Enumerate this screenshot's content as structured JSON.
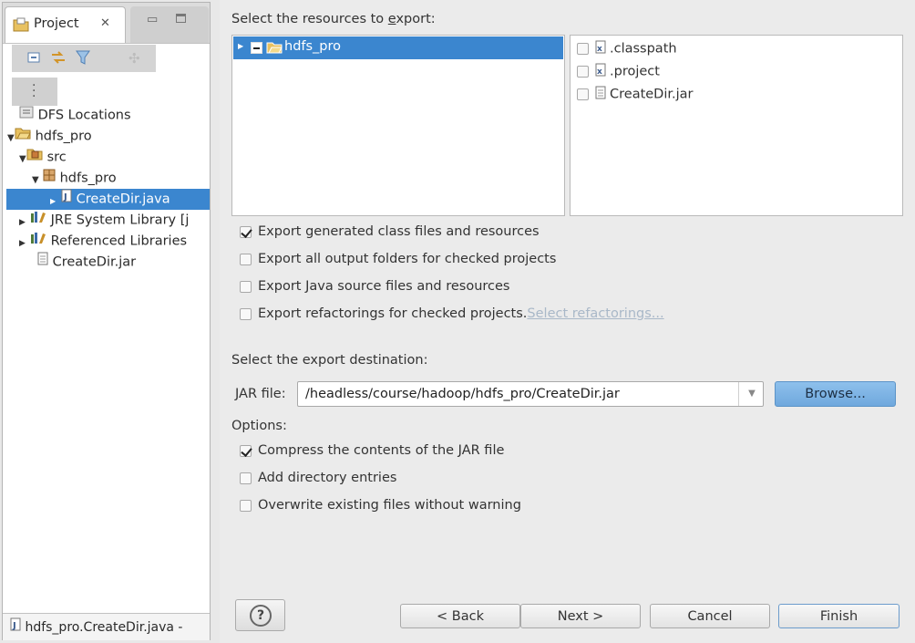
{
  "explorer": {
    "tab_label": "Project",
    "tree": [
      {
        "label": "DFS Locations"
      },
      {
        "label": "hdfs_pro"
      },
      {
        "label": "src"
      },
      {
        "label": "hdfs_pro"
      },
      {
        "label": "CreateDir.java"
      },
      {
        "label": "JRE System Library [j"
      },
      {
        "label": "Referenced Libraries"
      },
      {
        "label": "CreateDir.jar"
      }
    ],
    "status": "hdfs_pro.CreateDir.java -"
  },
  "wizard": {
    "resources_heading": "Select the resources to export:",
    "project_node": "hdfs_pro",
    "files": [
      ".classpath",
      ".project",
      "CreateDir.jar"
    ],
    "export_options": [
      {
        "label": "Export generated class files and resources",
        "checked": true
      },
      {
        "label": "Export all output folders for checked projects",
        "checked": false
      },
      {
        "label": "Export Java source files and resources",
        "checked": false
      },
      {
        "label": "Export refactorings for checked projects.",
        "checked": false
      }
    ],
    "select_refactorings_link": "Select refactorings...",
    "destination_heading": "Select the export destination:",
    "jar_file_label": "JAR file:",
    "jar_file_value": "/headless/course/hadoop/hdfs_pro/CreateDir.jar",
    "browse_label": "Browse...",
    "options_heading": "Options:",
    "options": [
      {
        "label": "Compress the contents of the JAR file",
        "checked": true
      },
      {
        "label": "Add directory entries",
        "checked": false
      },
      {
        "label": "Overwrite existing files without warning",
        "checked": false
      }
    ],
    "buttons": {
      "help": "?",
      "back": "< Back",
      "next": "Next >",
      "cancel": "Cancel",
      "finish": "Finish"
    }
  },
  "colors": {
    "selection": "#3b86cf",
    "browse_button": "#7db4e6",
    "link_disabled": "#a9b8c8"
  }
}
